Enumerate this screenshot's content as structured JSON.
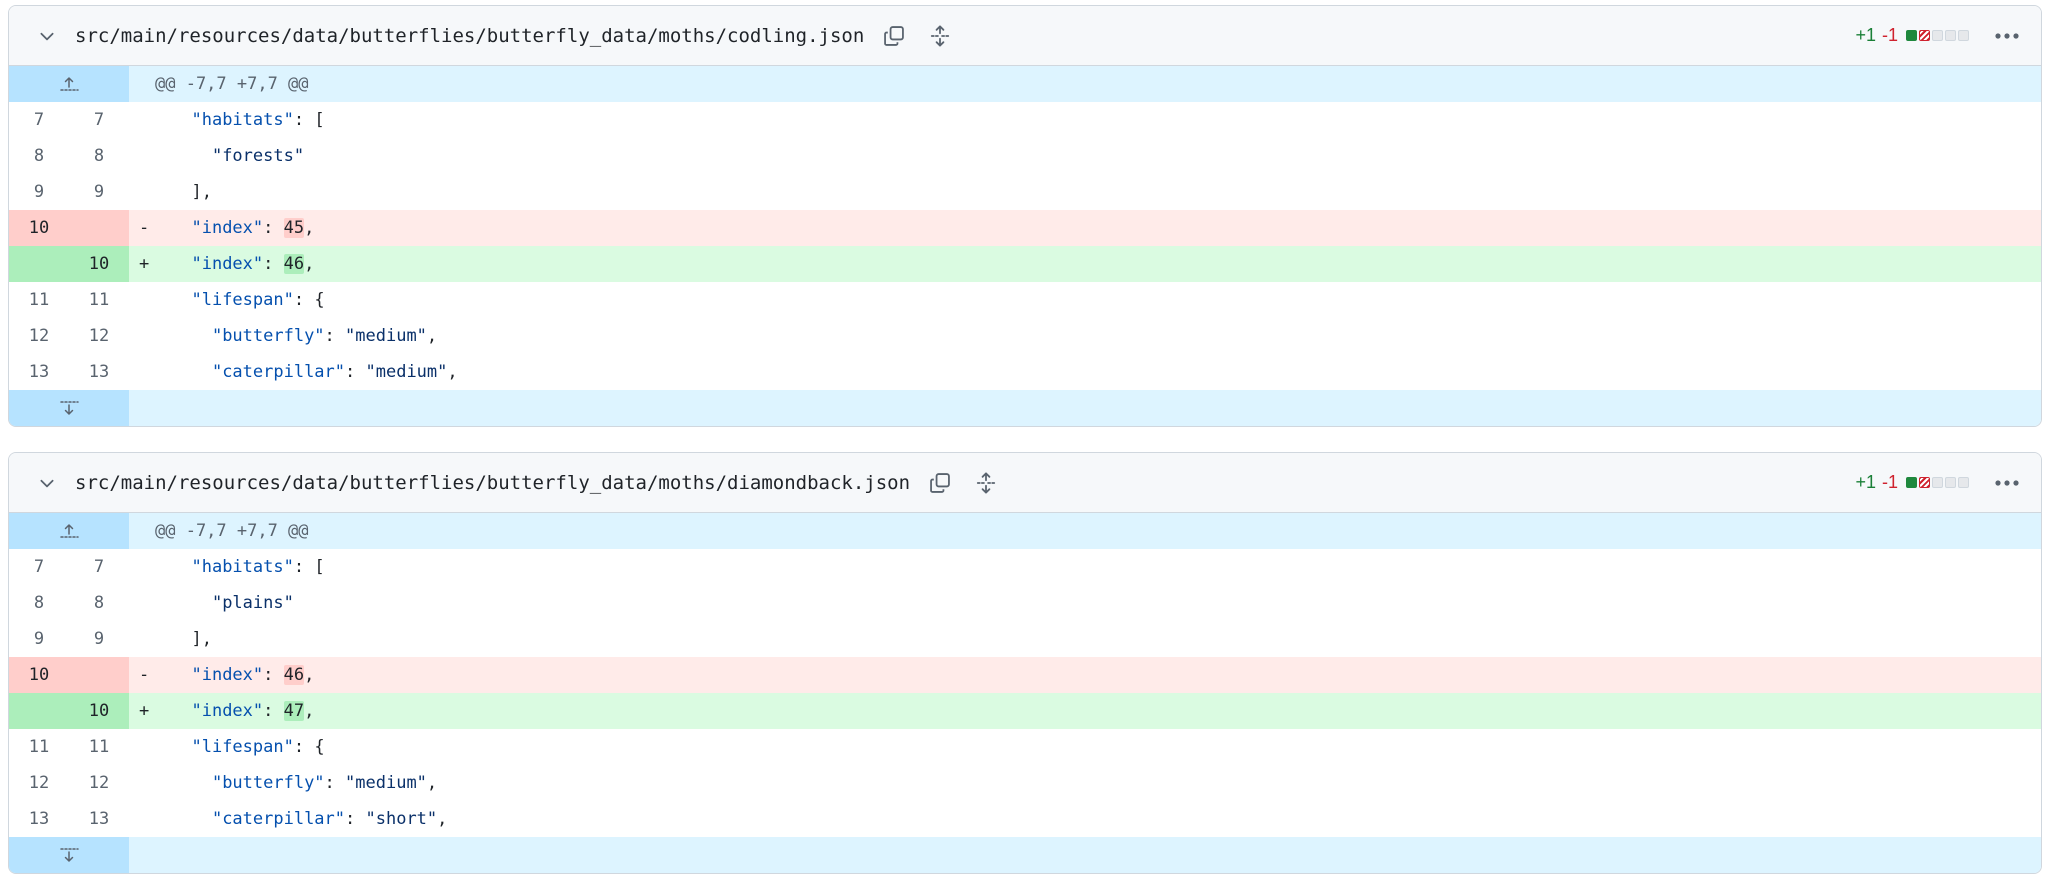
{
  "files": [
    {
      "path": "src/main/resources/data/butterflies/butterfly_data/moths/codling.json",
      "additions": "+1",
      "deletions": "-1",
      "hunk_header": "@@ -7,7 +7,7 @@",
      "lines": {
        "l7": {
          "old": "7",
          "new": "7",
          "key": "\"habitats\"",
          "rest": ": ["
        },
        "l8": {
          "old": "8",
          "new": "8",
          "str": "\"forests\""
        },
        "l9": {
          "old": "9",
          "new": "9",
          "text": "],"
        },
        "del": {
          "old": "10",
          "marker": "-",
          "key": "\"index\"",
          "sep": ": ",
          "value": "45",
          "tail": ","
        },
        "add": {
          "new": "10",
          "marker": "+",
          "key": "\"index\"",
          "sep": ": ",
          "value": "46",
          "tail": ","
        },
        "l11": {
          "old": "11",
          "new": "11",
          "key": "\"lifespan\"",
          "rest": ": {"
        },
        "l12": {
          "old": "12",
          "new": "12",
          "key": "\"butterfly\"",
          "sep": ": ",
          "str": "\"medium\"",
          "tail": ","
        },
        "l13": {
          "old": "13",
          "new": "13",
          "key": "\"caterpillar\"",
          "sep": ": ",
          "str": "\"medium\"",
          "tail": ","
        }
      }
    },
    {
      "path": "src/main/resources/data/butterflies/butterfly_data/moths/diamondback.json",
      "additions": "+1",
      "deletions": "-1",
      "hunk_header": "@@ -7,7 +7,7 @@",
      "lines": {
        "l7": {
          "old": "7",
          "new": "7",
          "key": "\"habitats\"",
          "rest": ": ["
        },
        "l8": {
          "old": "8",
          "new": "8",
          "str": "\"plains\""
        },
        "l9": {
          "old": "9",
          "new": "9",
          "text": "],"
        },
        "del": {
          "old": "10",
          "marker": "-",
          "key": "\"index\"",
          "sep": ": ",
          "value": "46",
          "tail": ","
        },
        "add": {
          "new": "10",
          "marker": "+",
          "key": "\"index\"",
          "sep": ": ",
          "value": "47",
          "tail": ","
        },
        "l11": {
          "old": "11",
          "new": "11",
          "key": "\"lifespan\"",
          "rest": ": {"
        },
        "l12": {
          "old": "12",
          "new": "12",
          "key": "\"butterfly\"",
          "sep": ": ",
          "str": "\"medium\"",
          "tail": ","
        },
        "l13": {
          "old": "13",
          "new": "13",
          "key": "\"caterpillar\"",
          "sep": ": ",
          "str": "\"short\"",
          "tail": ","
        }
      }
    }
  ],
  "icons": {
    "collapse": "chevron-down-icon",
    "copy": "copy-icon",
    "expand_all": "unfold-icon",
    "more": "kebab-horizontal-icon",
    "expand_up": "fold-up-icon",
    "expand_down": "fold-down-icon"
  },
  "colors": {
    "addition": "#1a7f37",
    "deletion": "#cf222e",
    "hunk_bg": "#ddf4ff"
  }
}
